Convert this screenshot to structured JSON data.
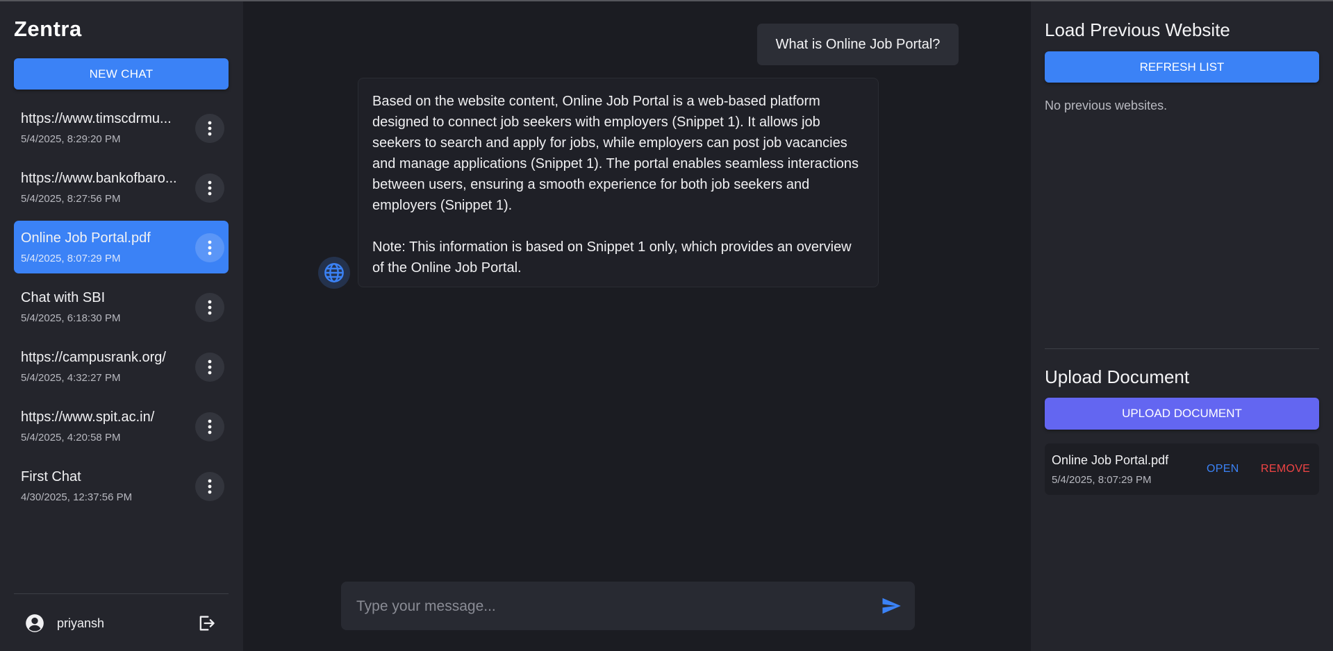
{
  "app": {
    "title": "Zentra"
  },
  "sidebar": {
    "new_chat_label": "NEW CHAT",
    "chats": [
      {
        "title": "https://www.timscdrmu...",
        "date": "5/4/2025, 8:29:20 PM",
        "active": false
      },
      {
        "title": "https://www.bankofbaro...",
        "date": "5/4/2025, 8:27:56 PM",
        "active": false
      },
      {
        "title": "Online Job Portal.pdf",
        "date": "5/4/2025, 8:07:29 PM",
        "active": true
      },
      {
        "title": "Chat with SBI",
        "date": "5/4/2025, 6:18:30 PM",
        "active": false
      },
      {
        "title": "https://campusrank.org/",
        "date": "5/4/2025, 4:32:27 PM",
        "active": false
      },
      {
        "title": "https://www.spit.ac.in/",
        "date": "5/4/2025, 4:20:58 PM",
        "active": false
      },
      {
        "title": "First Chat",
        "date": "4/30/2025, 12:37:56 PM",
        "active": false
      }
    ],
    "user": {
      "name": "priyansh"
    }
  },
  "chat": {
    "user_message": "What is Online Job Portal?",
    "bot_message": {
      "paragraph1": "Based on the website content, Online Job Portal is a web-based platform designed to connect job seekers with employers (Snippet 1). It allows job seekers to search and apply for jobs, while employers can post job vacancies and manage applications (Snippet 1). The portal enables seamless interactions between users, ensuring a smooth experience for both job seekers and employers (Snippet 1).",
      "paragraph2": "Note: This information is based on Snippet 1 only, which provides an overview of the Online Job Portal."
    },
    "input": {
      "placeholder": "Type your message...",
      "value": ""
    }
  },
  "right_panel": {
    "load_title": "Load Previous Website",
    "refresh_label": "REFRESH LIST",
    "no_previous": "No previous websites.",
    "upload_title": "Upload Document",
    "upload_label": "UPLOAD DOCUMENT",
    "documents": [
      {
        "name": "Online Job Portal.pdf",
        "date": "5/4/2025, 8:07:29 PM",
        "open_label": "OPEN",
        "remove_label": "REMOVE"
      }
    ]
  },
  "icons": {
    "chat_menu": "more-vertical-icon",
    "user": "account-circle-icon",
    "logout": "logout-icon",
    "bot": "globe-icon",
    "send": "send-icon"
  },
  "colors": {
    "primary": "#3b82f6",
    "upload": "#6366f1",
    "remove": "#ef4444",
    "sidebar_bg": "#24252c",
    "main_bg": "#1b1c22"
  }
}
